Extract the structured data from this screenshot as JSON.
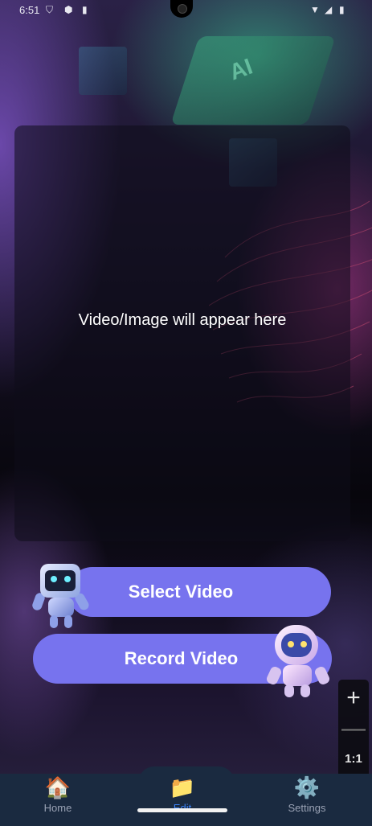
{
  "status_bar": {
    "time": "6:51",
    "icons": [
      "shield-icon",
      "play-protect-icon",
      "sd-card-icon",
      "wifi-icon",
      "signal-icon",
      "battery-icon"
    ]
  },
  "background": {
    "chip_label": "AI"
  },
  "preview": {
    "placeholder": "Video/Image will appear here"
  },
  "actions": {
    "select_label": "Select Video",
    "record_label": "Record Video",
    "button_color": "#7773ee"
  },
  "zoom_panel": {
    "plus": "+",
    "minus": "—",
    "ratio": "1:1"
  },
  "nav": {
    "items": [
      {
        "label": "Home",
        "icon": "home-icon",
        "glyph": "🏠"
      },
      {
        "label": "Edit",
        "icon": "folder-icon",
        "glyph": "📁",
        "active": true
      },
      {
        "label": "Settings",
        "icon": "gear-icon",
        "glyph": "⚙️"
      }
    ],
    "active_color": "#3b82f6"
  }
}
